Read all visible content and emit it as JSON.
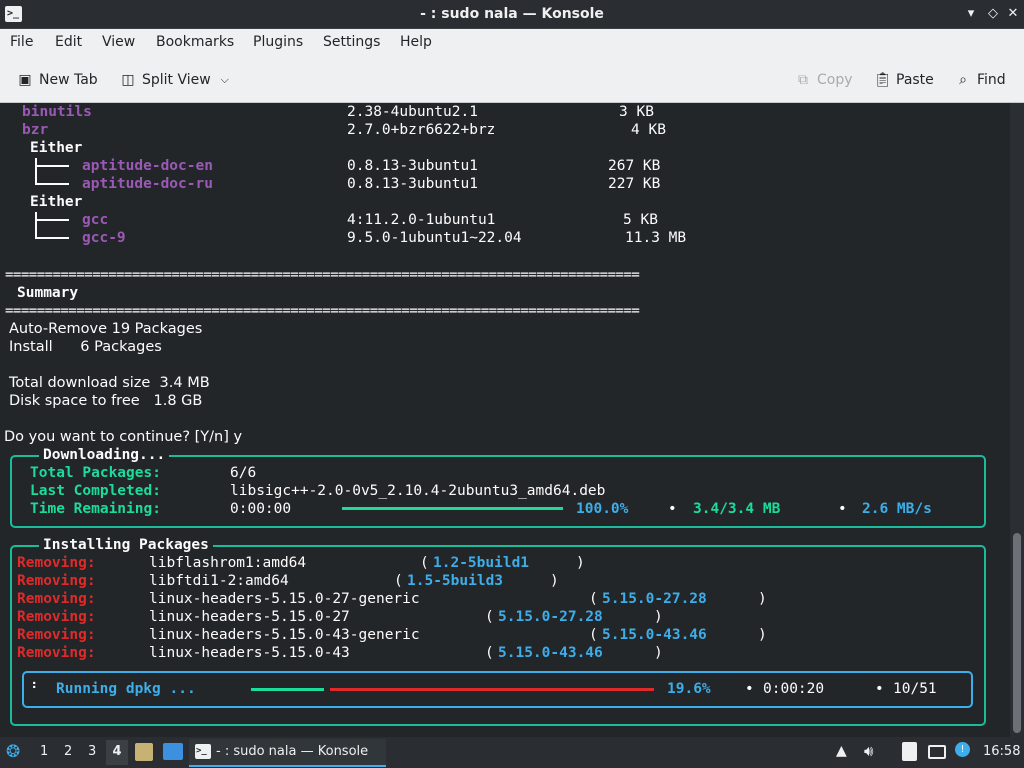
{
  "window": {
    "title": "- : sudo nala — Konsole",
    "app_icon": ">_",
    "minimize_icon": "▾",
    "maximize_icon": "◇",
    "close_icon": "✕"
  },
  "menu": [
    "File",
    "Edit",
    "View",
    "Bookmarks",
    "Plugins",
    "Settings",
    "Help"
  ],
  "toolbar": {
    "new_tab": "New Tab",
    "split_view": "Split View",
    "copy": "Copy",
    "paste": "Paste",
    "find": "Find"
  },
  "terminal": {
    "packages": [
      {
        "name": "binutils",
        "version": "2.38-4ubuntu2.1",
        "size": "3 KB"
      },
      {
        "name": "bzr",
        "version": "2.7.0+bzr6622+brz",
        "size": "4 KB"
      }
    ],
    "either_groups": [
      {
        "label": "Either",
        "items": [
          {
            "name": "aptitude-doc-en",
            "version": "0.8.13-3ubuntu1",
            "size": "267 KB"
          },
          {
            "name": "aptitude-doc-ru",
            "version": "0.8.13-3ubuntu1",
            "size": "227 KB"
          }
        ]
      },
      {
        "label": "Either",
        "items": [
          {
            "name": "gcc",
            "version": "4:11.2.0-1ubuntu1",
            "size": "5 KB"
          },
          {
            "name": "gcc-9",
            "version": "9.5.0-1ubuntu1~22.04",
            "size": "11.3 MB"
          }
        ]
      }
    ],
    "separator": "================================================================================",
    "summary_title": "Summary",
    "summary_lines": [
      "Auto-Remove 19 Packages",
      "Install      6 Packages",
      "",
      "Total download size  3.4 MB",
      "Disk space to free   1.8 GB"
    ],
    "prompt": "Do you want to continue? [Y/n] y",
    "download": {
      "title": "Downloading...",
      "total_label": "Total Packages:",
      "total_value": "6/6",
      "last_label": "Last Completed:",
      "last_value": "libsigc++-2.0-0v5_2.10.4-2ubuntu3_amd64.deb",
      "time_label": "Time Remaining:",
      "time_value": "0:00:00",
      "percent": "100.0%",
      "progress": 1.0,
      "size": "3.4/3.4 MB",
      "speed": "2.6 MB/s",
      "bullet": "•"
    },
    "install": {
      "title": "Installing Packages",
      "rows": [
        {
          "action": "Removing:",
          "pkg": "libflashrom1:amd64",
          "ver": "1.2-5build1"
        },
        {
          "action": "Removing:",
          "pkg": "libftdi1-2:amd64",
          "ver": "1.5-5build3"
        },
        {
          "action": "Removing:",
          "pkg": "linux-headers-5.15.0-27-generic",
          "ver": "5.15.0-27.28"
        },
        {
          "action": "Removing:",
          "pkg": "linux-headers-5.15.0-27",
          "ver": "5.15.0-27.28"
        },
        {
          "action": "Removing:",
          "pkg": "linux-headers-5.15.0-43-generic",
          "ver": "5.15.0-43.46"
        },
        {
          "action": "Removing:",
          "pkg": "linux-headers-5.15.0-43",
          "ver": "5.15.0-43.46"
        }
      ],
      "open_paren": "(",
      "close_paren": ")",
      "spinner": "⠃",
      "running": "Running dpkg ...",
      "percent": "19.6%",
      "progress": 0.196,
      "elapsed": "0:00:20",
      "count": "10/51",
      "bullet": "•"
    }
  },
  "taskbar": {
    "desktops": [
      "1",
      "2",
      "3",
      "4"
    ],
    "active_desktop": "4",
    "task_label": "- : sudo nala — Konsole",
    "clock": "16:58"
  },
  "colors": {
    "accent": "#1abc9c",
    "package_name": "#9b59b6",
    "removing": "#e02a2a",
    "version": "#3daee9",
    "terminal_bg": "#232629"
  }
}
